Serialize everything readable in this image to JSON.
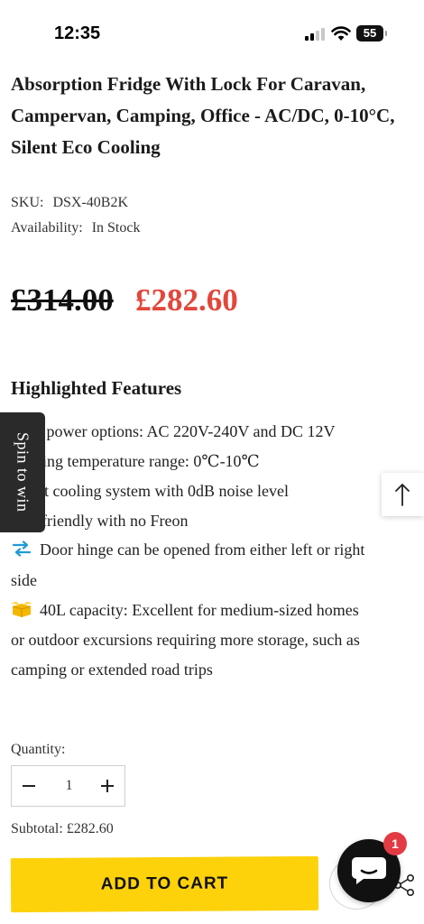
{
  "status_bar": {
    "time": "12:35",
    "battery": "55"
  },
  "product": {
    "title": "Absorption Fridge With Lock For Caravan, Campervan, Camping, Office - AC/DC, 0-10°C, Silent Eco Cooling",
    "sku_label": "SKU:",
    "sku_value": "DSX-40B2K",
    "availability_label": "Availability:",
    "availability_value": "In Stock",
    "price_old": "£314.00",
    "price_new": "£282.60"
  },
  "features": {
    "heading": "Highlighted Features",
    "lines": [
      "Dual power options: AC 220V-240V and DC 12V",
      "Cooling temperature range: 0℃-10℃",
      "Silent cooling system with 0dB noise level",
      "Eco-friendly with no Freon",
      "Door hinge can be opened from either left or right",
      "side",
      "40L capacity: Excellent for medium-sized homes",
      "or outdoor excursions requiring more storage, such as",
      "camping or extended road trips"
    ]
  },
  "spin_tab": {
    "label": "Spin to win"
  },
  "quantity": {
    "label": "Quantity:",
    "value": "1"
  },
  "subtotal": "Subtotal: £282.60",
  "cart": {
    "add_label": "ADD TO CART"
  },
  "chat": {
    "badge_count": "1"
  },
  "colors": {
    "sale_price": "#e2473b",
    "cart_button": "#fdd20a",
    "chat_badge": "#e33b44"
  }
}
